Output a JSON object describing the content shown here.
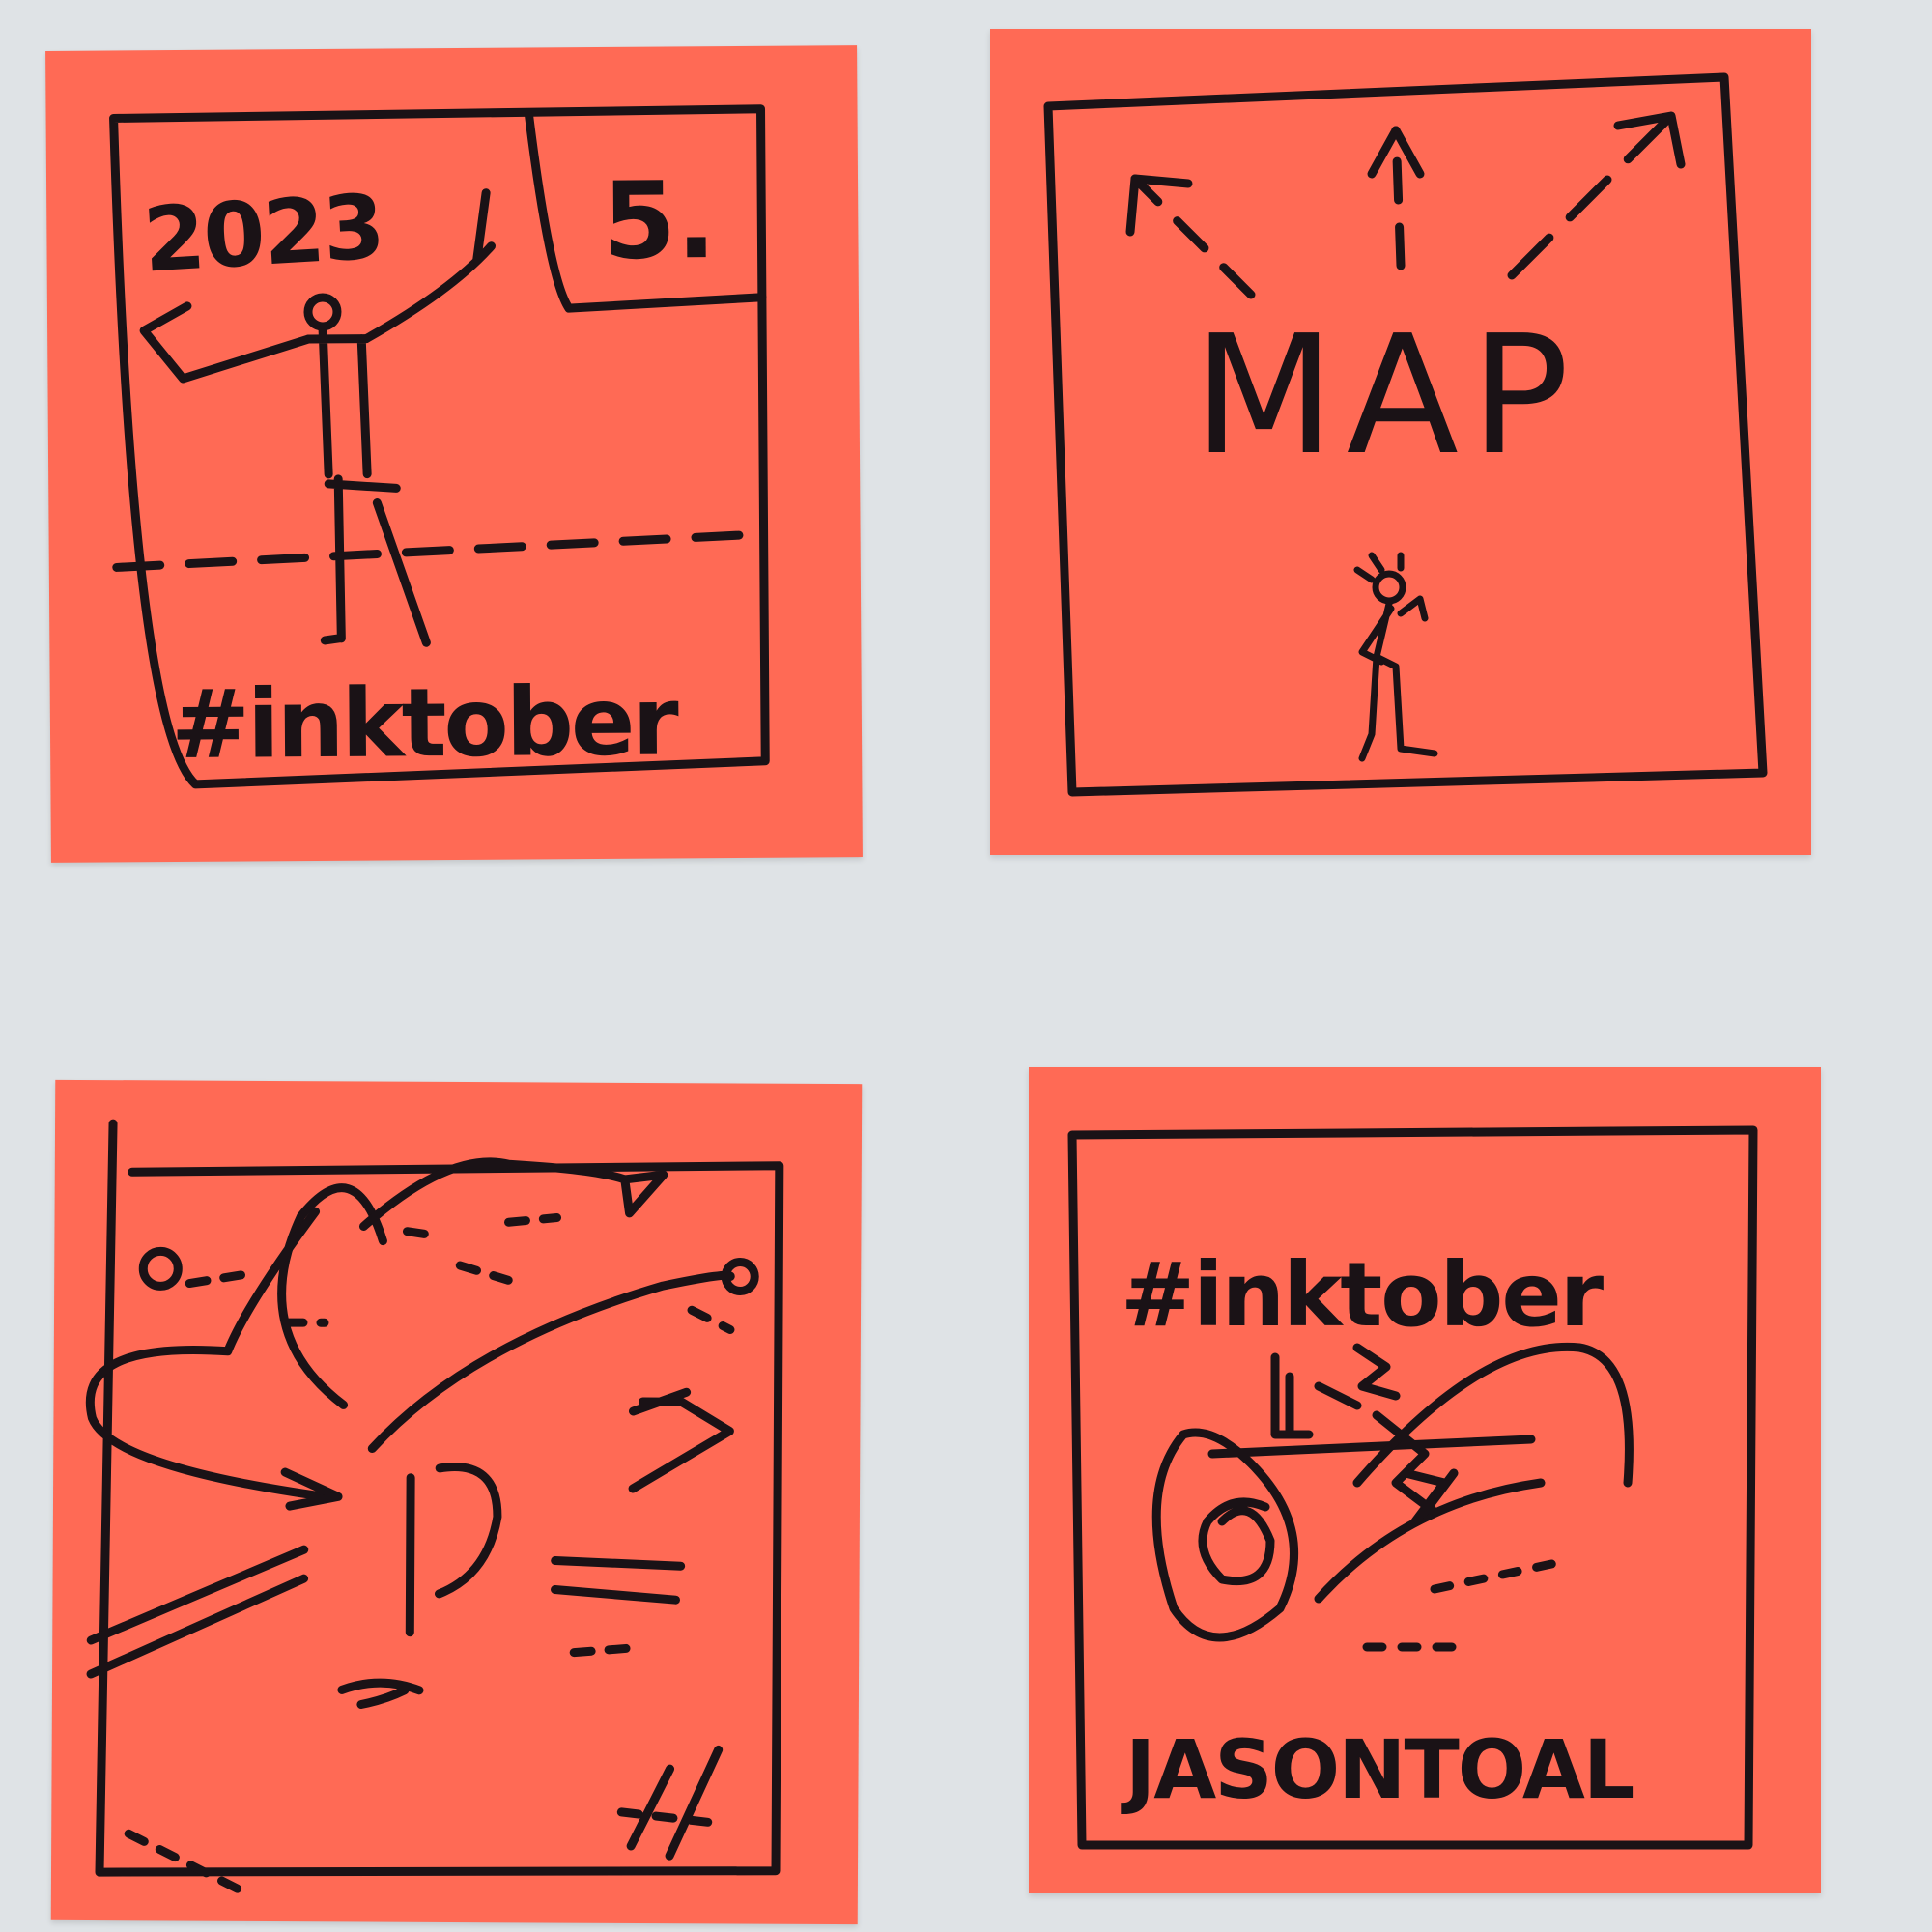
{
  "notes": {
    "top_left": {
      "year": "2023",
      "day": "5.",
      "tag": "#inktober"
    },
    "top_right": {
      "word": "MAP"
    },
    "bottom_left": {},
    "bottom_right": {
      "tag": "#inktober",
      "signature": "JASONTOAL"
    }
  },
  "colors": {
    "note": "#ff6a55",
    "ink": "#1a1216",
    "wall": "#dfe3e6"
  }
}
